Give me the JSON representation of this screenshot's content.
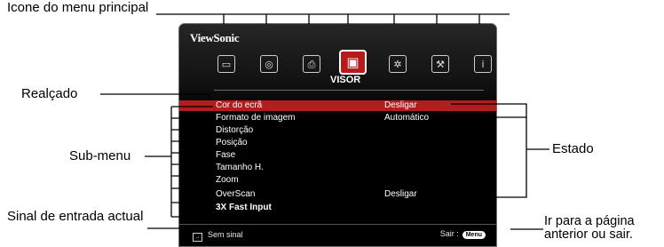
{
  "callouts": {
    "main_menu_icon": "Icone do menu principal",
    "highlight": "Realçado",
    "submenu": "Sub-menu",
    "status": "Estado",
    "input_signal": "Sinal de entrada actual",
    "go_back": "Ir para a página anterior ou sair."
  },
  "osd": {
    "brand": "ViewSonic",
    "selected_menu": "VISOR",
    "menu_icons": [
      "monitor-icon",
      "palette-icon",
      "setup-icon",
      "display-icon",
      "gear-icon",
      "tools-icon",
      "info-icon"
    ],
    "items": [
      {
        "label": "Cor do ecrã",
        "value": "Desligar"
      },
      {
        "label": "Formato de imagem",
        "value": "Automático"
      },
      {
        "label": "Distorção",
        "value": ""
      },
      {
        "label": "Posição",
        "value": ""
      },
      {
        "label": "Fase",
        "value": ""
      },
      {
        "label": "Tamanho H.",
        "value": ""
      },
      {
        "label": "Zoom",
        "value": ""
      },
      {
        "label": "OverScan",
        "value": "Desligar"
      },
      {
        "label": "3X Fast Input",
        "value": ""
      }
    ],
    "highlight_index": 0,
    "signal": "Sem sinal",
    "exit_label": "Sair :",
    "menu_button": "Menu"
  },
  "colors": {
    "highlight": "#b01e1e",
    "background": "#000000"
  }
}
